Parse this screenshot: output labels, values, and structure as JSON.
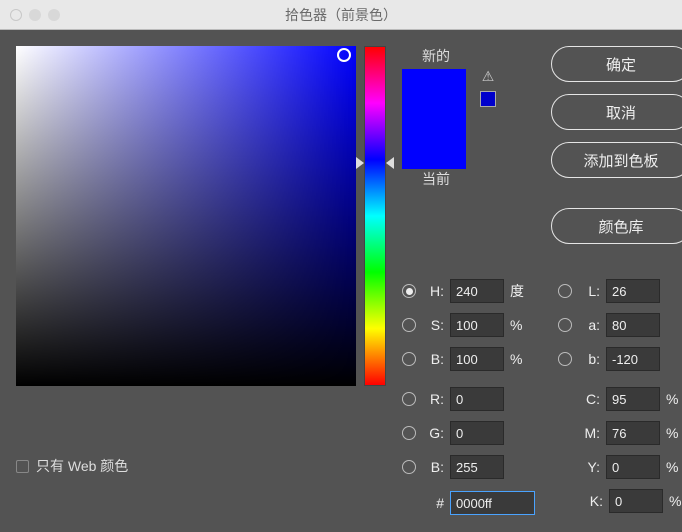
{
  "title": "拾色器（前景色）",
  "buttons": {
    "ok": "确定",
    "cancel": "取消",
    "add": "添加到色板",
    "lib": "颜色库"
  },
  "preview": {
    "new_label": "新的",
    "current_label": "当前"
  },
  "webonly_label": "只有 Web 颜色",
  "hsb": {
    "h": {
      "label": "H:",
      "value": "240",
      "unit": "度"
    },
    "s": {
      "label": "S:",
      "value": "100",
      "unit": "%"
    },
    "b": {
      "label": "B:",
      "value": "100",
      "unit": "%"
    }
  },
  "lab": {
    "l": {
      "label": "L:",
      "value": "26"
    },
    "a": {
      "label": "a:",
      "value": "80"
    },
    "b": {
      "label": "b:",
      "value": "-120"
    }
  },
  "rgb": {
    "r": {
      "label": "R:",
      "value": "0"
    },
    "g": {
      "label": "G:",
      "value": "0"
    },
    "b": {
      "label": "B:",
      "value": "255"
    }
  },
  "cmyk": {
    "c": {
      "label": "C:",
      "value": "95",
      "unit": "%"
    },
    "m": {
      "label": "M:",
      "value": "76",
      "unit": "%"
    },
    "y": {
      "label": "Y:",
      "value": "0",
      "unit": "%"
    },
    "k": {
      "label": "K:",
      "value": "0",
      "unit": "%"
    }
  },
  "hex": {
    "label": "#",
    "value": "0000ff"
  }
}
